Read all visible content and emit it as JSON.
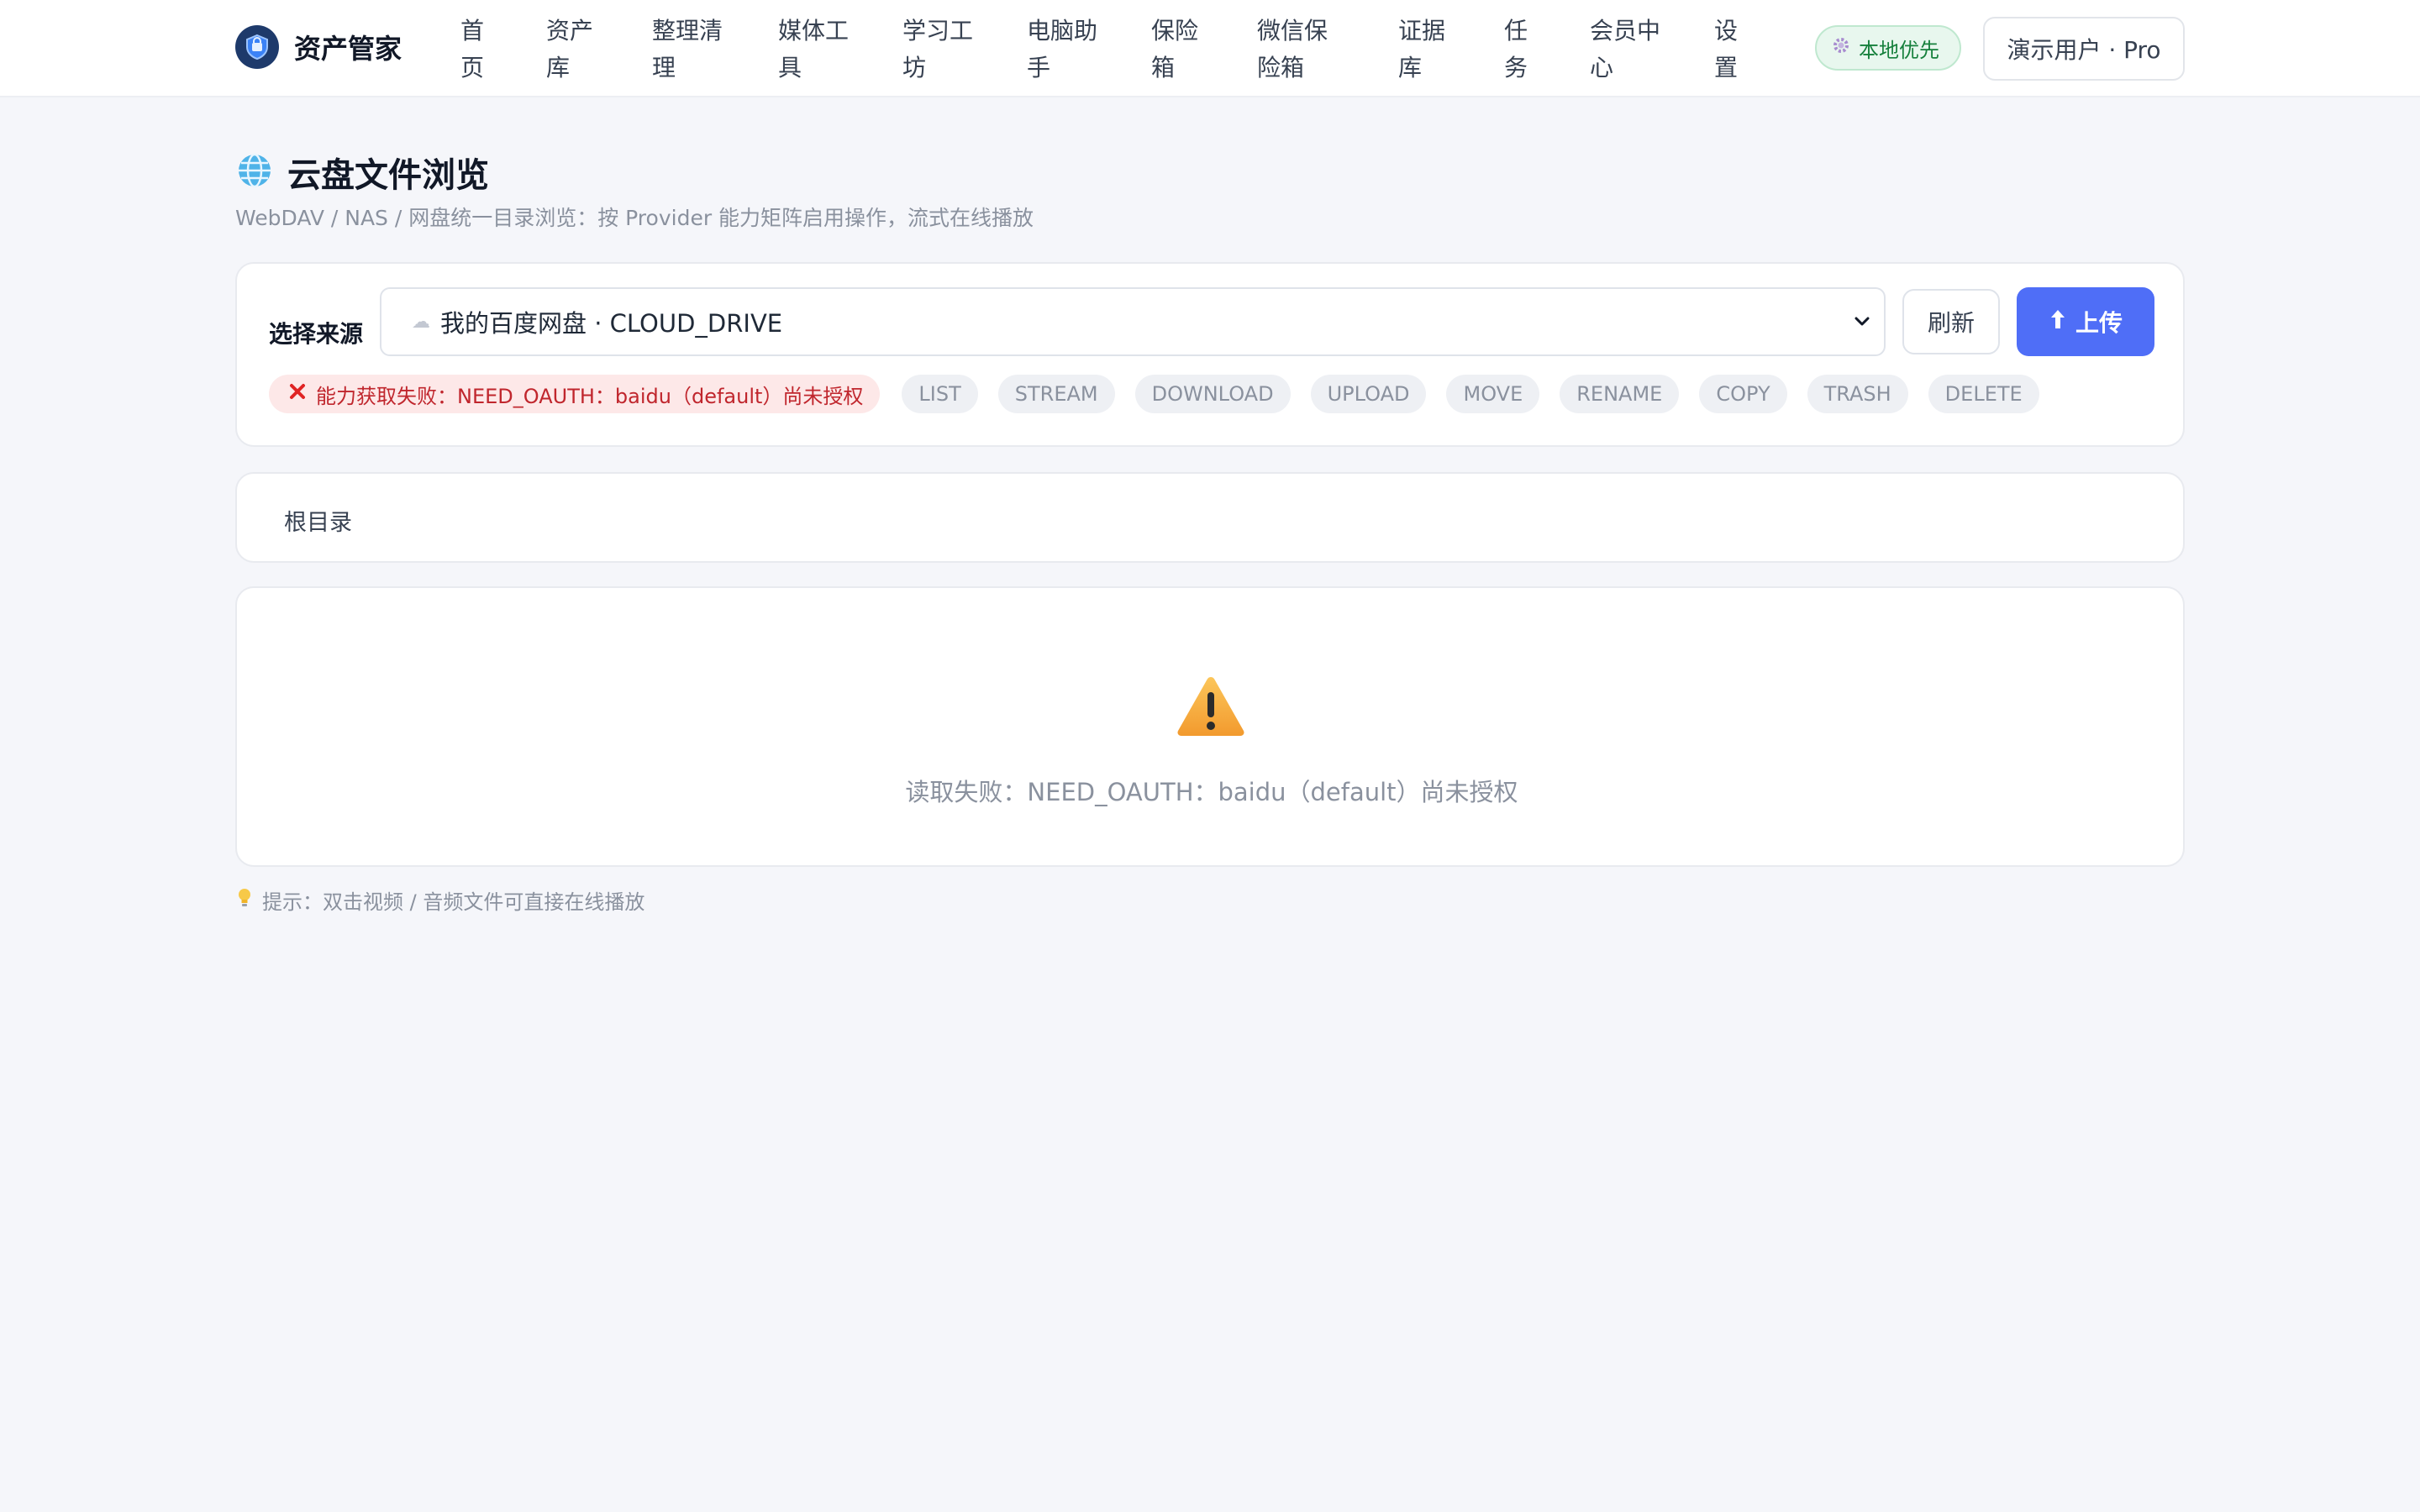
{
  "app": {
    "name": "资产管家"
  },
  "nav": {
    "items": [
      "首页",
      "资产库",
      "整理清理",
      "媒体工具",
      "学习工坊",
      "电脑助手",
      "保险箱",
      "微信保险箱",
      "证据库",
      "任务",
      "会员中心",
      "设置"
    ]
  },
  "header_right": {
    "badge": "本地优先",
    "user": "演示用户 · Pro"
  },
  "page": {
    "icon": "globe-icon",
    "title": "云盘文件浏览",
    "subtitle": "WebDAV / NAS / 网盘统一目录浏览：按 Provider 能力矩阵启用操作，流式在线播放"
  },
  "source": {
    "label": "选择来源",
    "selected": "我的百度网盘 · CLOUD_DRIVE",
    "refresh": "刷新",
    "upload": "上传"
  },
  "capabilities": {
    "error": "能力获取失败：NEED_OAUTH：baidu（default）尚未授权",
    "tags": [
      "LIST",
      "STREAM",
      "DOWNLOAD",
      "UPLOAD",
      "MOVE",
      "RENAME",
      "COPY",
      "TRASH",
      "DELETE"
    ]
  },
  "breadcrumb": {
    "root": "根目录"
  },
  "empty_state": {
    "icon": "warning-icon",
    "message": "读取失败：NEED_OAUTH：baidu（default）尚未授权"
  },
  "hint": {
    "text": "提示：双击视频 / 音频文件可直接在线播放"
  },
  "colors": {
    "accent": "#4f6ef7",
    "error": "#c0262d",
    "success": "#16803c"
  }
}
